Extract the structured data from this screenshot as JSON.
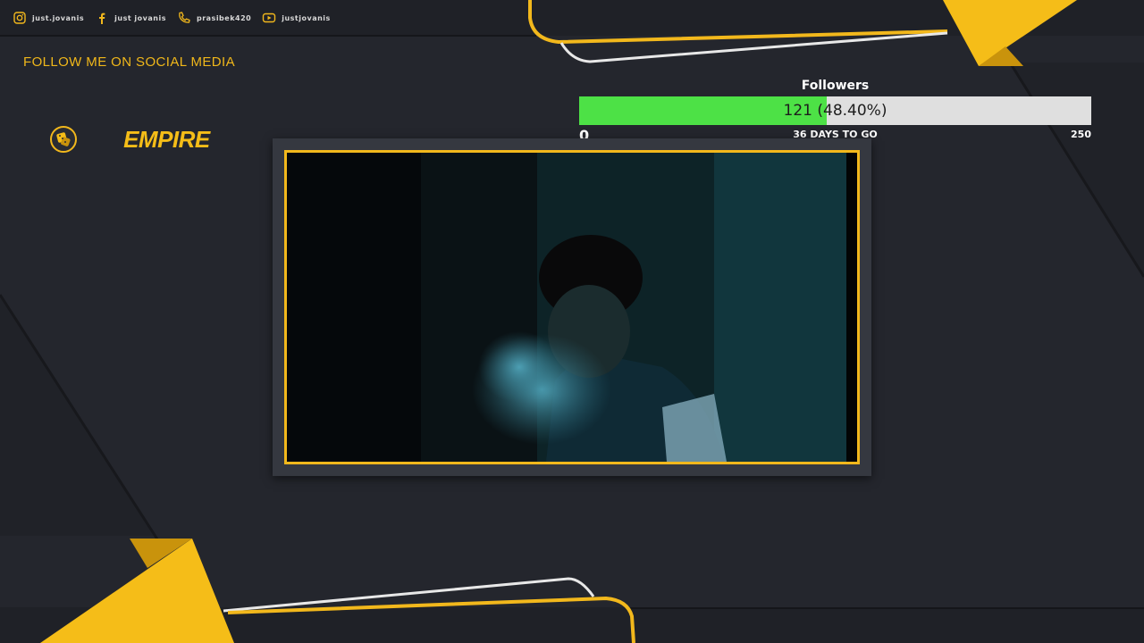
{
  "colors": {
    "background": "#24262d",
    "accent_yellow": "#f5bd18",
    "progress_green": "#4de146",
    "progress_track": "#dfdfdf"
  },
  "social": {
    "items": [
      {
        "icon": "instagram-icon",
        "label": "just.jovanis"
      },
      {
        "icon": "facebook-icon",
        "label": "just jovanis"
      },
      {
        "icon": "phone-icon",
        "label": "prasibek420"
      },
      {
        "icon": "youtube-icon",
        "label": "justjovanis"
      }
    ]
  },
  "follow_heading": "FOLLOW ME ON SOCIAL MEDIA",
  "brand": {
    "logo_icon": "dice-icon",
    "name": "EMPIRE"
  },
  "followers_goal": {
    "title": "Followers",
    "current": 121,
    "goal": 250,
    "progress_fraction": 0.484,
    "progress_text": "121 (48.40%)",
    "min_label": "0",
    "max_label": "250",
    "days_left": "36 DAYS TO GO"
  },
  "webcam": {
    "description_icon": "webcam-feed"
  }
}
